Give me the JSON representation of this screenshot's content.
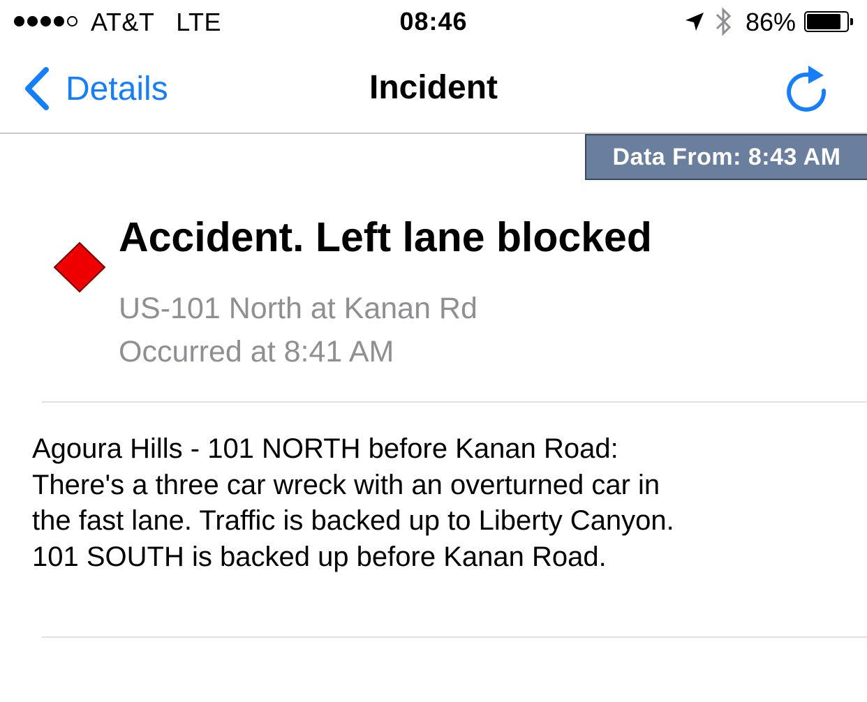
{
  "status_bar": {
    "signal_bars": 4,
    "signal_max": 5,
    "carrier": "AT&T",
    "network": "LTE",
    "time": "08:46",
    "battery_percent": "86%",
    "battery_level": 0.86,
    "icons": [
      "location-arrow-icon",
      "bluetooth-icon",
      "battery-icon"
    ]
  },
  "nav": {
    "back_label": "Details",
    "title": "Incident",
    "back_icon": "chevron-left-icon",
    "refresh_icon": "refresh-icon",
    "tint_color": "#157efb"
  },
  "data_from": {
    "label": "Data From: 8:43 AM",
    "background_color": "#6a7f9d"
  },
  "incident": {
    "severity_icon": "red-diamond-icon",
    "severity_color": "#ee0000",
    "title": "Accident. Left lane blocked",
    "location": "US-101 North at Kanan Rd",
    "occurred": "Occurred at 8:41 AM",
    "description": "Agoura Hills - 101 NORTH before Kanan Road: There's a three car wreck with an overturned car in the fast lane. Traffic is backed up to Liberty Canyon. 101 SOUTH is backed up before Kanan Road."
  }
}
